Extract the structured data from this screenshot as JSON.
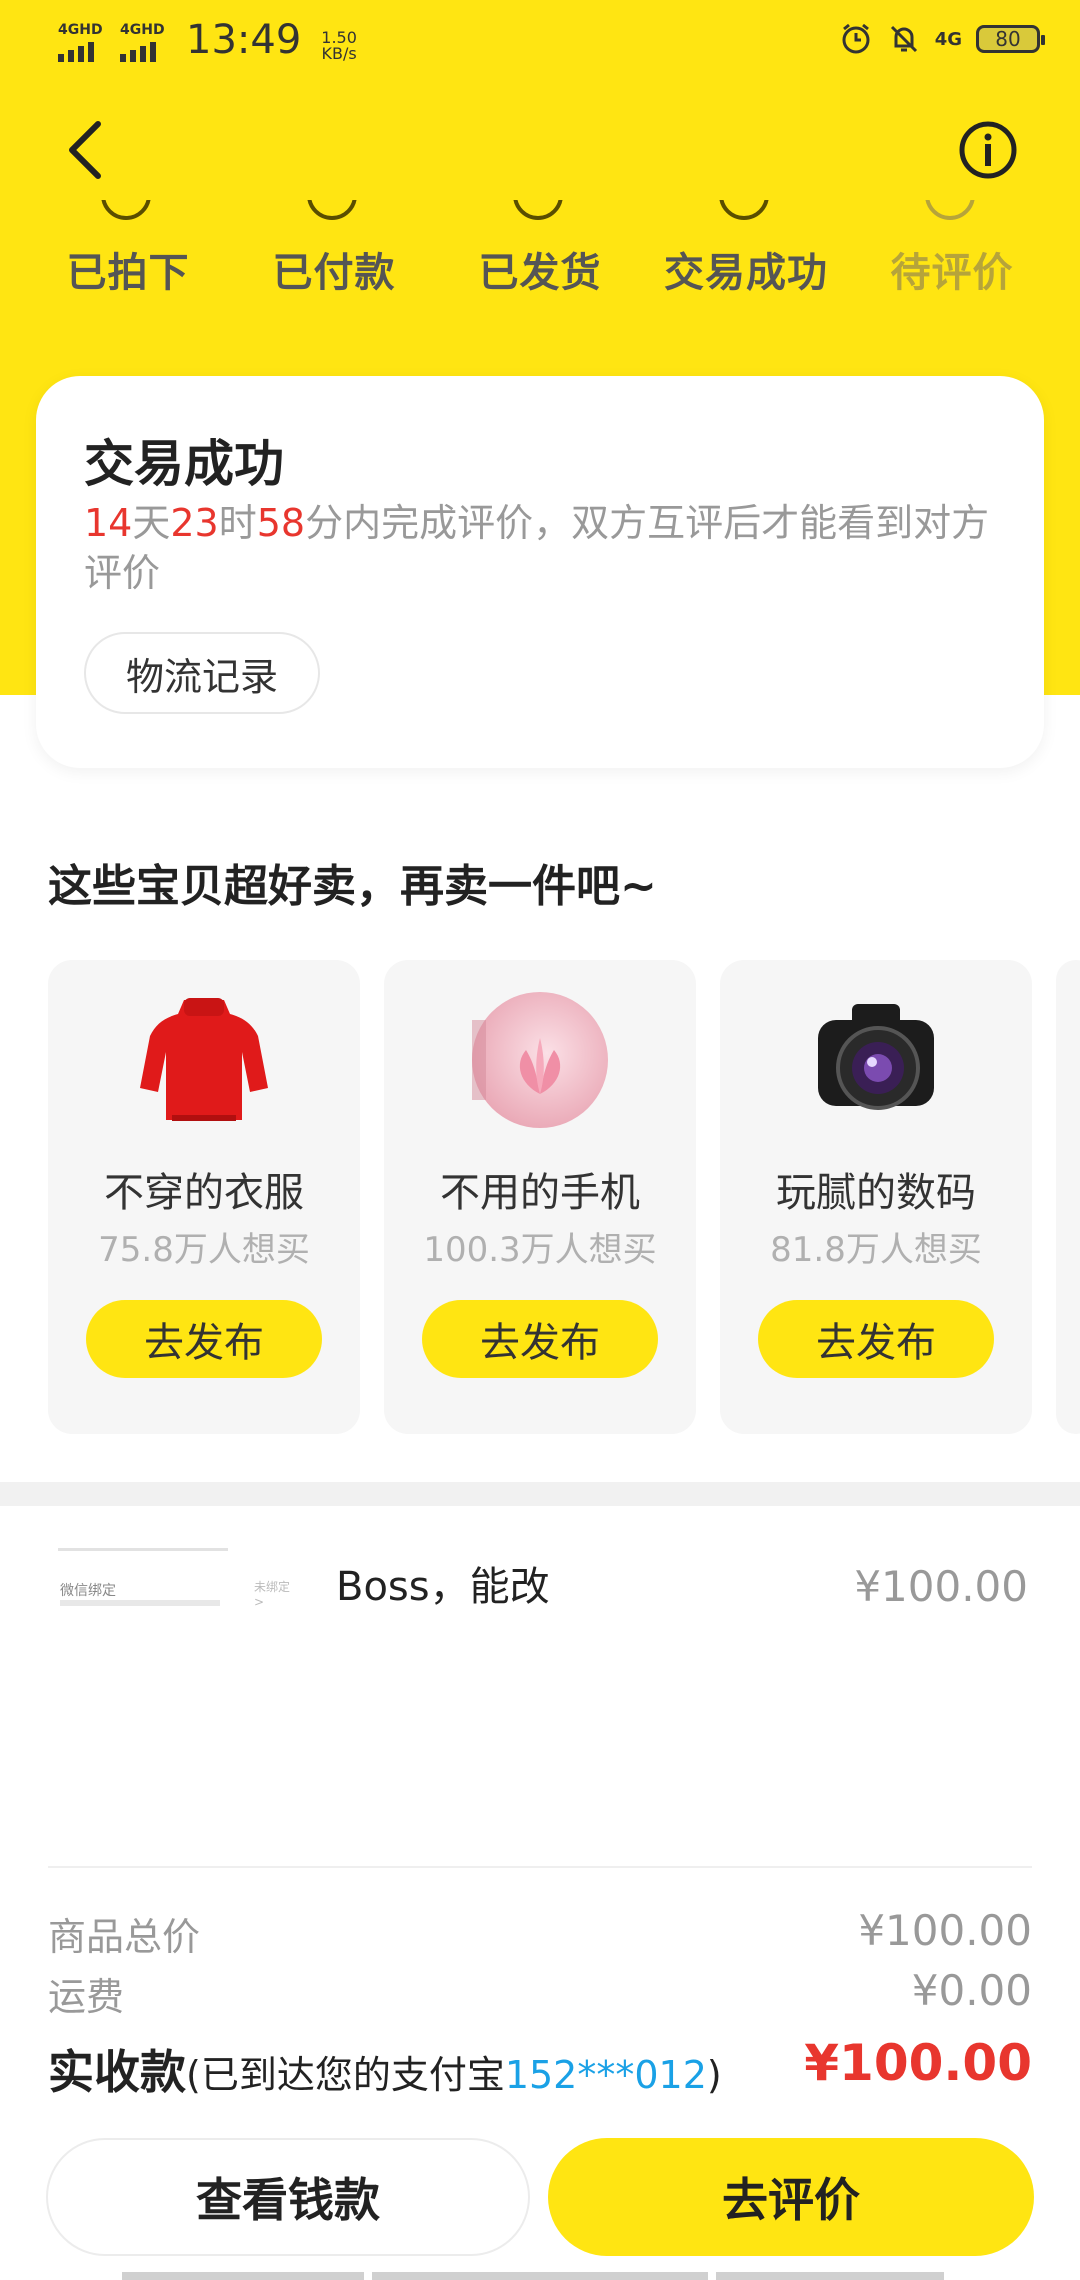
{
  "status_bar": {
    "signal1": "4GHD",
    "signal2": "4GHD",
    "time": "13:49",
    "speed_value": "1.50",
    "speed_unit": "KB/s",
    "network": "4G",
    "battery": "80"
  },
  "steps": [
    {
      "label": "已拍下"
    },
    {
      "label": "已付款"
    },
    {
      "label": "已发货"
    },
    {
      "label": "交易成功"
    },
    {
      "label": "待评价"
    }
  ],
  "status_card": {
    "title": "交易成功",
    "countdown": {
      "days": "14",
      "days_unit": "天",
      "hours": "23",
      "hours_unit": "时",
      "minutes": "58",
      "minutes_unit": "分"
    },
    "desc_rest": "内完成评价，双方互评后才能看到对方评价",
    "logistics_button": "物流记录"
  },
  "suggestion": {
    "title": "这些宝贝超好卖，再卖一件吧~",
    "items": [
      {
        "name": "不穿的衣服",
        "count": "75.8万人想买",
        "button": "去发布",
        "icon": "red-sweater-image"
      },
      {
        "name": "不用的手机",
        "count": "100.3万人想买",
        "button": "去发布",
        "icon": "pink-lotus-phone-image"
      },
      {
        "name": "玩腻的数码",
        "count": "81.8万人想买",
        "button": "去发布",
        "icon": "camera-image"
      }
    ]
  },
  "item": {
    "thumb_label": "微信绑定",
    "thumb_status": "未绑定 >",
    "title": "Boss，能改",
    "price": "¥100.00"
  },
  "summary": {
    "subtotal_label": "商品总价",
    "subtotal_value": "¥100.00",
    "shipping_label": "运费",
    "shipping_value": "¥0.00",
    "net_label": "实收款",
    "net_note_prefix": "(已到达您的支付宝",
    "net_account": "152***012",
    "net_note_suffix": ")",
    "net_value": "¥100.00"
  },
  "actions": {
    "view_payment": "查看钱款",
    "review": "去评价"
  },
  "colors": {
    "brand_yellow": "#FFE512",
    "red": "#E8362E",
    "blue": "#1aa1e6"
  }
}
